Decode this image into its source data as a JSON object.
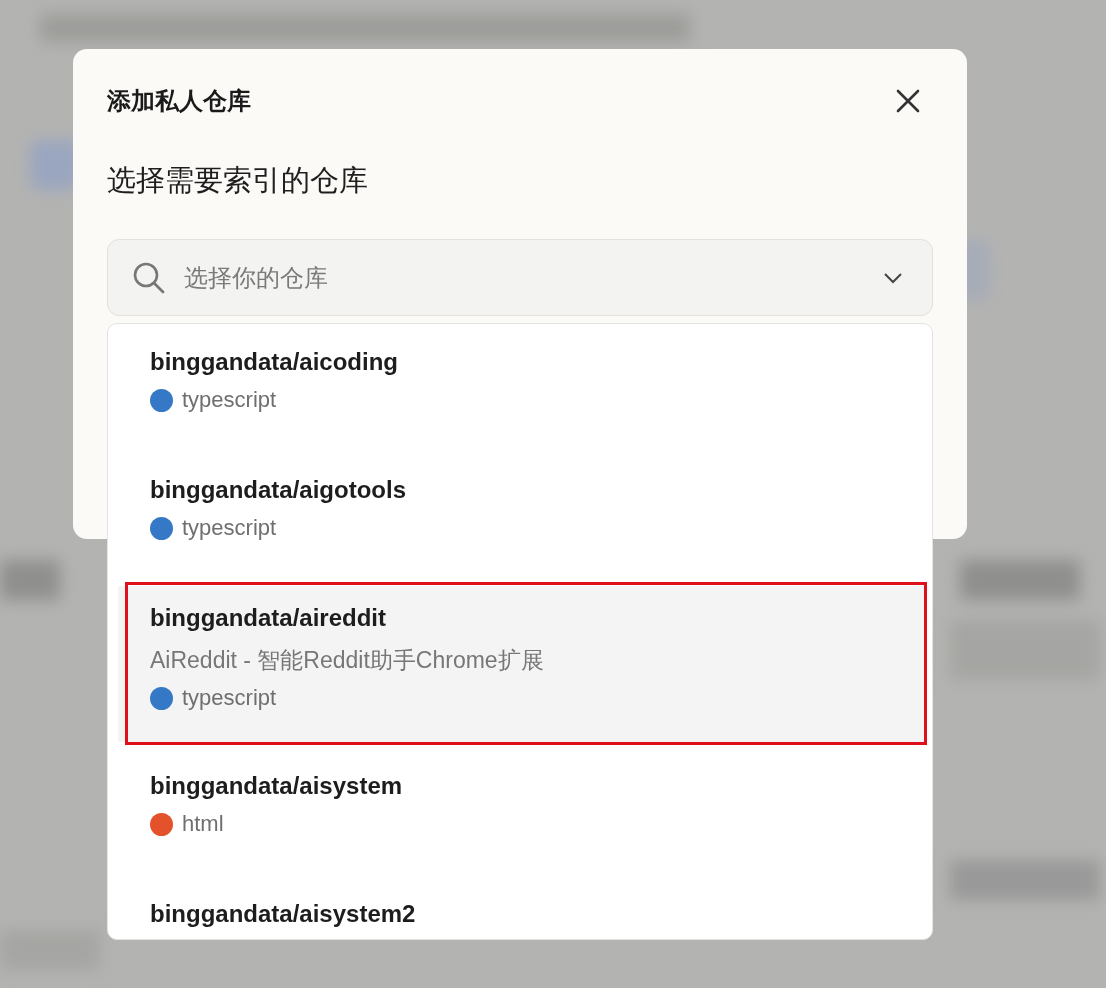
{
  "dialog": {
    "title": "添加私人仓库",
    "subtitle": "选择需要索引的仓库",
    "search": {
      "placeholder": "选择你的仓库"
    },
    "repos": [
      {
        "name": "binggandata/aicoding",
        "language": "typescript",
        "color": "#3478c6",
        "selected": false,
        "marked": false
      },
      {
        "name": "binggandata/aigotools",
        "language": "typescript",
        "color": "#3478c6",
        "selected": false,
        "marked": false
      },
      {
        "name": "binggandata/aireddit",
        "description": "AiReddit - 智能Reddit助手Chrome扩展",
        "language": "typescript",
        "color": "#3478c6",
        "selected": true,
        "marked": true
      },
      {
        "name": "binggandata/aisystem",
        "language": "html",
        "color": "#e4522b",
        "selected": false,
        "marked": false
      },
      {
        "name": "binggandata/aisystem2",
        "selected": false,
        "marked": false
      }
    ]
  }
}
